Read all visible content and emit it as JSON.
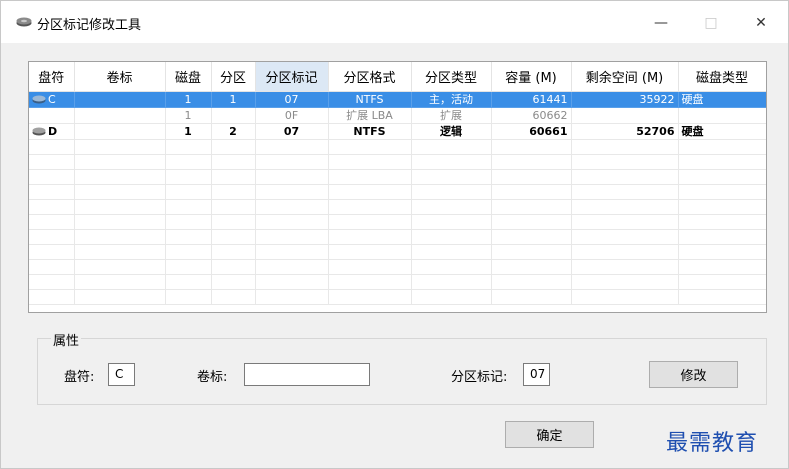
{
  "window": {
    "title": "分区标记修改工具",
    "minimize": "—",
    "maximize": "□",
    "close": "✕"
  },
  "table": {
    "headers": [
      "盘符",
      "卷标",
      "磁盘",
      "分区",
      "分区标记",
      "分区格式",
      "分区类型",
      "容量 (M)",
      "剩余空间 (M)",
      "磁盘类型"
    ],
    "rows": [
      {
        "drive": "C",
        "label": "",
        "disk": "1",
        "part": "1",
        "mark": "07",
        "format": "NTFS",
        "type": "主，活动",
        "capacity": "61441",
        "free": "35922",
        "disk_type": "硬盘",
        "icon": "disk-icon"
      },
      {
        "drive": "",
        "label": "",
        "disk": "1",
        "part": "",
        "mark": "0F",
        "format": "扩展 LBA",
        "type": "扩展",
        "capacity": "60662",
        "free": "",
        "disk_type": ""
      },
      {
        "drive": "D",
        "label": "",
        "disk": "1",
        "part": "2",
        "mark": "07",
        "format": "NTFS",
        "type": "逻辑",
        "capacity": "60661",
        "free": "52706",
        "disk_type": "硬盘",
        "icon": "disk-icon"
      }
    ],
    "selected_color": "#3a8ee6"
  },
  "properties": {
    "group_title": "属性",
    "drive_label": "盘符:",
    "drive_value": "C",
    "volume_label": "卷标:",
    "volume_value": "",
    "mark_label": "分区标记:",
    "mark_value": "07",
    "modify_button": "修改"
  },
  "footer": {
    "ok_button": "确定"
  },
  "watermark": "最需教育"
}
